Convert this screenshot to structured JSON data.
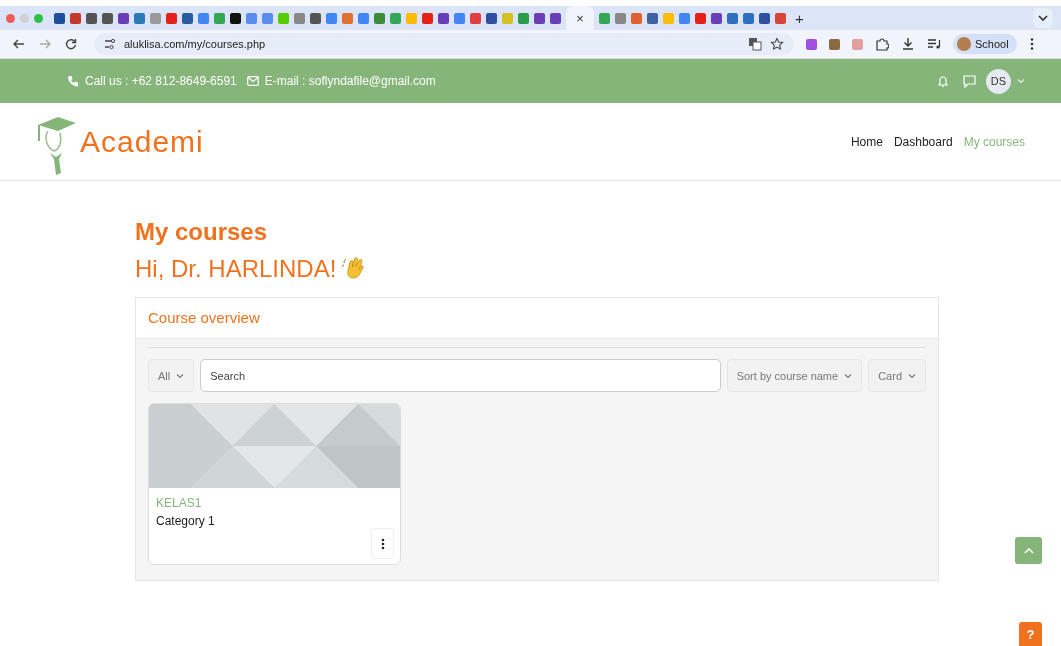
{
  "browser": {
    "close_tab": "×",
    "new_tab": "+",
    "url": "aluklisa.com/my/courses.php",
    "profile": "School"
  },
  "topbar": {
    "phone": "Call us : +62 812-8649-6591",
    "email": "E-mail : soflyndafile@gmail.com",
    "avatar": "DS"
  },
  "brand": "Academi",
  "nav": [
    {
      "label": "Home",
      "selected": false
    },
    {
      "label": "Dashboard",
      "selected": false
    },
    {
      "label": "My courses",
      "selected": true
    }
  ],
  "page_title": "My courses",
  "greeting": "Hi, Dr. HARLINDA!",
  "overview": {
    "title": "Course overview",
    "filter": "All",
    "search_placeholder": "Search",
    "sort": "Sort by course name",
    "view": "Card",
    "courses": [
      {
        "name": "KELAS1",
        "category": "Category 1"
      }
    ]
  },
  "help": "?"
}
